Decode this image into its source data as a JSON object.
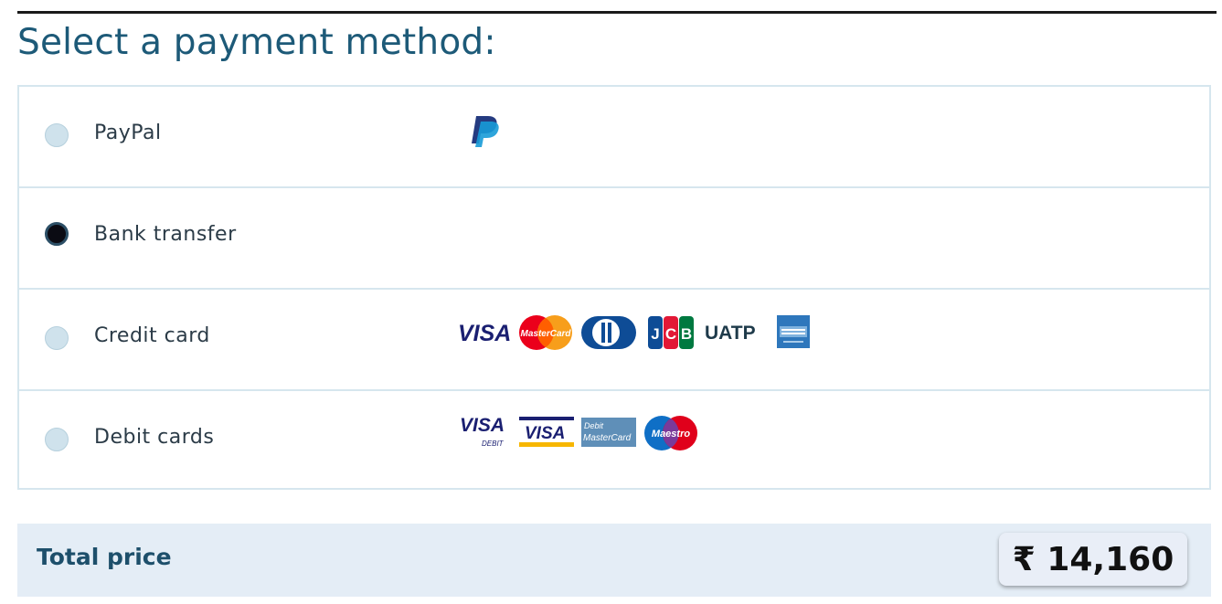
{
  "heading": "Select a payment method:",
  "methods": [
    {
      "label": "PayPal",
      "selected": false,
      "icons": [
        "paypal-icon"
      ]
    },
    {
      "label": "Bank transfer",
      "selected": true,
      "icons": []
    },
    {
      "label": "Credit card",
      "selected": false,
      "icons": [
        "visa-icon",
        "mastercard-icon",
        "diners-club-icon",
        "jcb-icon",
        "uatp-icon",
        "american-express-icon"
      ]
    },
    {
      "label": "Debit cards",
      "selected": false,
      "icons": [
        "visa-debit-icon",
        "visa-electron-icon",
        "debit-mastercard-icon",
        "maestro-icon"
      ]
    }
  ],
  "logo_text": {
    "visa": "VISA",
    "mastercard": "MasterCard",
    "uatp": "UATP",
    "visa_debit_sub": "DEBIT",
    "debit_mastercard_top": "Debit",
    "debit_mastercard_bottom": "MasterCard",
    "maestro": "Maestro"
  },
  "total": {
    "label": "Total price",
    "amount": "₹ 14,160"
  },
  "colors": {
    "heading": "#1d5a78",
    "row_border": "#d6e6ee",
    "radio_unselected": "#cfe2ec",
    "radio_selected": "#0b0b13",
    "total_bar": "#e4edf6",
    "total_label": "#1d4f6b"
  }
}
